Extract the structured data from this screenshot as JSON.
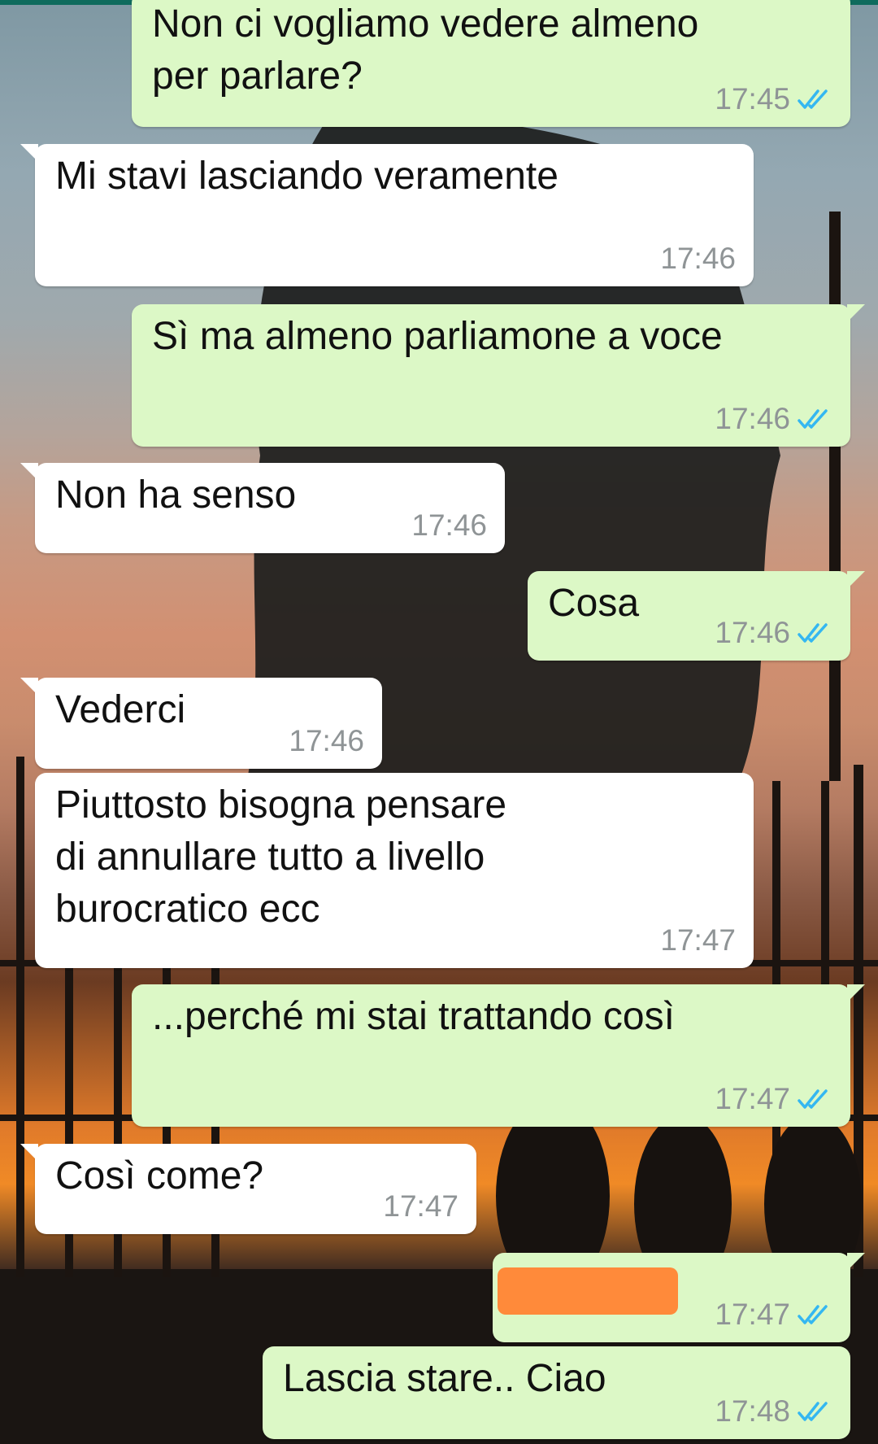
{
  "colors": {
    "incoming_bubble": "#ffffff",
    "outgoing_bubble": "#dcf8c6",
    "timestamp": "#8f9496",
    "read_ticks": "#34b7f1",
    "redaction": "#ff8a3a"
  },
  "messages": [
    {
      "direction": "out",
      "text": "Non ci vogliamo vedere almeno\nper parlare?",
      "time": "17:45",
      "status": "read"
    },
    {
      "direction": "in",
      "text": "Mi stavi lasciando veramente",
      "time": "17:46"
    },
    {
      "direction": "out",
      "text": "Sì ma almeno parliamone a voce",
      "time": "17:46",
      "status": "read"
    },
    {
      "direction": "in",
      "text": "Non ha senso",
      "time": "17:46"
    },
    {
      "direction": "out",
      "text": "Cosa",
      "time": "17:46",
      "status": "read"
    },
    {
      "direction": "in",
      "text": "Vederci",
      "time": "17:46"
    },
    {
      "direction": "in",
      "text": "Piuttosto bisogna pensare\ndi annullare tutto a livello\nburocratico ecc",
      "time": "17:47"
    },
    {
      "direction": "out",
      "text": "...perché mi stai trattando così",
      "time": "17:47",
      "status": "read"
    },
    {
      "direction": "in",
      "text": "Così come?",
      "time": "17:47"
    },
    {
      "direction": "out",
      "text": "",
      "redacted": true,
      "time": "17:47",
      "status": "read"
    },
    {
      "direction": "out",
      "text": "Lascia stare.. Ciao",
      "time": "17:48",
      "status": "read"
    }
  ]
}
